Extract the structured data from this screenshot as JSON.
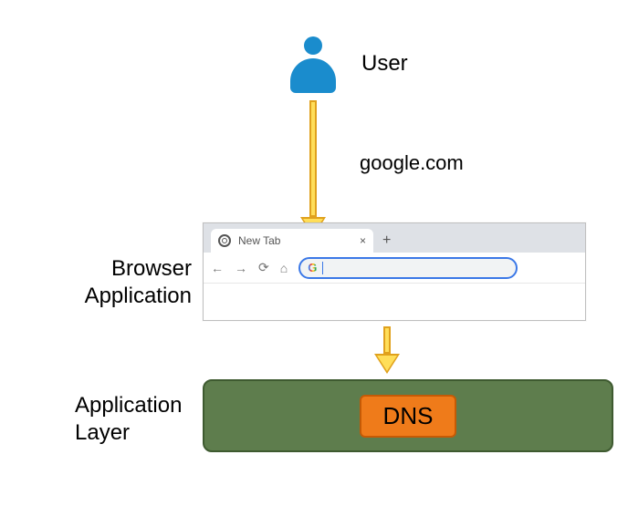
{
  "user": {
    "label": "User"
  },
  "arrow1": {
    "label": "google.com"
  },
  "browser": {
    "caption": "Browser\nApplication",
    "tab_title": "New Tab",
    "tab_close": "×",
    "new_tab": "+",
    "nav_back": "←",
    "nav_fwd": "→",
    "nav_reload": "⟳",
    "nav_home": "⌂",
    "omnibox_logo": "G",
    "omnibox_value": ""
  },
  "app_layer": {
    "caption": "Application\nLayer",
    "dns_label": "DNS"
  }
}
